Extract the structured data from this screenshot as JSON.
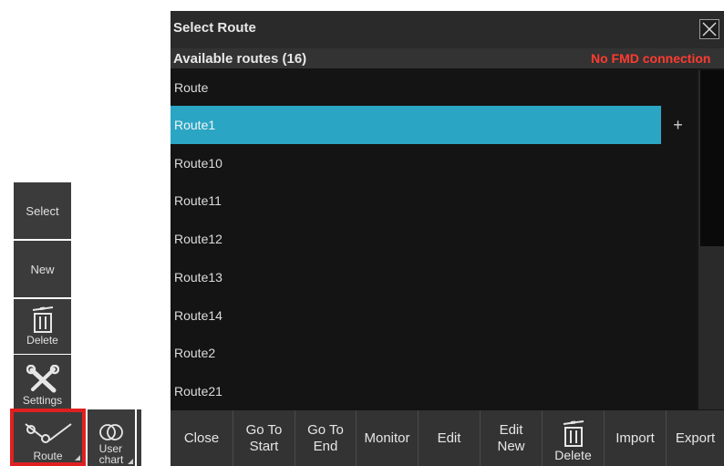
{
  "left_toolbar": {
    "select_label": "Select",
    "new_label": "New",
    "delete_label": "Delete",
    "settings_label": "Settings",
    "route_label": "Route",
    "user_chart_label": "User\nchart"
  },
  "dialog": {
    "title": "Select Route",
    "available_label": "Available routes (16)",
    "fmd_status": "No FMD connection",
    "status_color": "#ff3b30",
    "selected_color": "#2aa6c4",
    "column_header": "Route",
    "add_label": "+",
    "routes": [
      "Route1",
      "Route10",
      "Route11",
      "Route12",
      "Route13",
      "Route14",
      "Route2",
      "Route21"
    ],
    "selected_route": "Route1"
  },
  "bottom_bar": {
    "close": "Close",
    "go_to_start": "Go To\nStart",
    "go_to_end": "Go To\nEnd",
    "monitor": "Monitor",
    "edit": "Edit",
    "edit_new": "Edit\nNew",
    "delete": "Delete",
    "import": "Import",
    "export": "Export"
  }
}
